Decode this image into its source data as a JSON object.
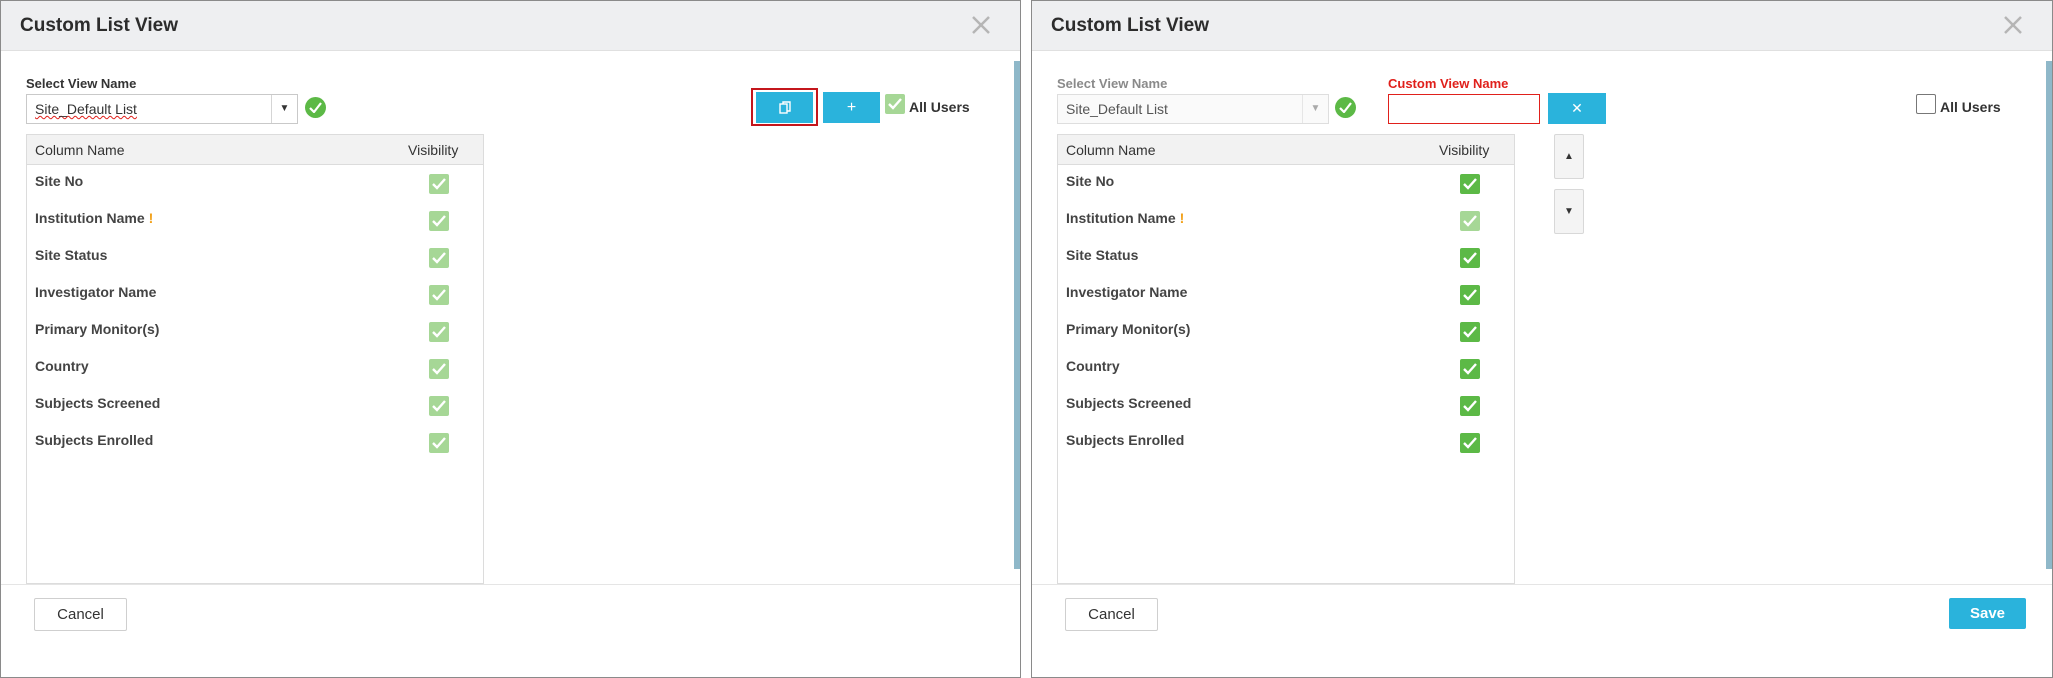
{
  "left_dialog": {
    "title": "Custom List View",
    "select_label": "Select View Name",
    "selected_view": "Site_Default List",
    "all_users_label": "All Users",
    "all_users_checked": true,
    "copy_button_icon": "copy-icon",
    "add_button_label": "+",
    "columns_header": {
      "name": "Column Name",
      "visibility": "Visibility"
    },
    "rows": [
      {
        "name": "Site No",
        "visible": true,
        "warning": ""
      },
      {
        "name": "Institution Name",
        "visible": true,
        "warning": "!"
      },
      {
        "name": "Site Status",
        "visible": true,
        "warning": ""
      },
      {
        "name": "Investigator Name",
        "visible": true,
        "warning": ""
      },
      {
        "name": "Primary Monitor(s)",
        "visible": true,
        "warning": ""
      },
      {
        "name": "Country",
        "visible": true,
        "warning": ""
      },
      {
        "name": "Subjects Screened",
        "visible": true,
        "warning": ""
      },
      {
        "name": "Subjects Enrolled",
        "visible": true,
        "warning": ""
      }
    ],
    "cancel_label": "Cancel"
  },
  "right_dialog": {
    "title": "Custom List View",
    "select_label": "Select View Name",
    "selected_view": "Site_Default List",
    "custom_view_label": "Custom View Name",
    "custom_view_value": "",
    "clear_button_label": "✕",
    "all_users_label": "All Users",
    "all_users_checked": false,
    "columns_header": {
      "name": "Column Name",
      "visibility": "Visibility"
    },
    "rows": [
      {
        "name": "Site No",
        "visible": true,
        "warning": ""
      },
      {
        "name": "Institution Name",
        "visible": true,
        "warning": "!"
      },
      {
        "name": "Site Status",
        "visible": true,
        "warning": ""
      },
      {
        "name": "Investigator Name",
        "visible": true,
        "warning": ""
      },
      {
        "name": "Primary Monitor(s)",
        "visible": true,
        "warning": ""
      },
      {
        "name": "Country",
        "visible": true,
        "warning": ""
      },
      {
        "name": "Subjects Screened",
        "visible": true,
        "warning": ""
      },
      {
        "name": "Subjects Enrolled",
        "visible": true,
        "warning": ""
      }
    ],
    "move_up_label": "▲",
    "move_down_label": "▼",
    "cancel_label": "Cancel",
    "save_label": "Save"
  },
  "colors": {
    "accent": "#2ab3dc",
    "success": "#5cb946",
    "error": "#e0201b",
    "warning": "#f2a11a"
  }
}
